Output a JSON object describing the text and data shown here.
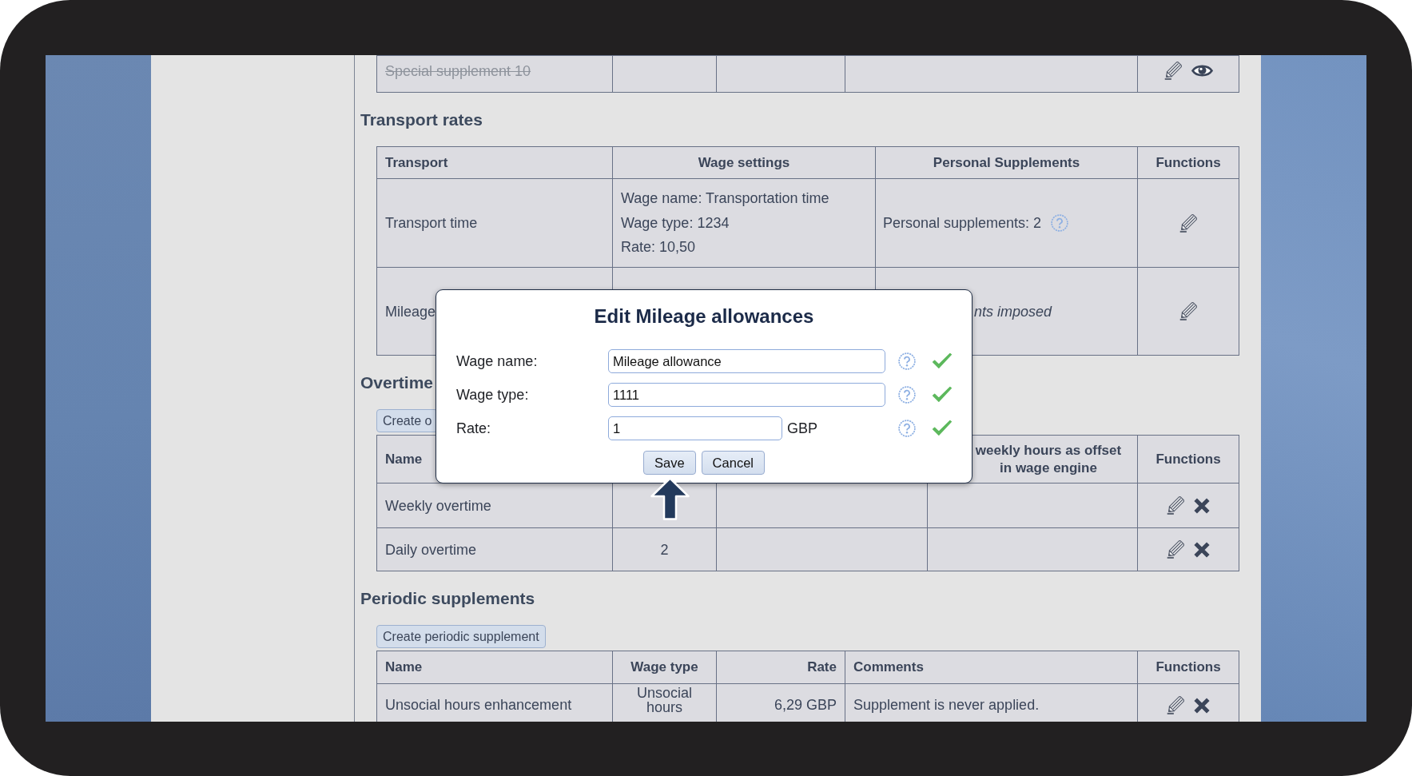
{
  "special_supplements": {
    "rows": [
      {
        "name": "Special supplement 10",
        "disabled": true,
        "actions": [
          {
            "kind": "edit"
          },
          {
            "kind": "view"
          }
        ]
      }
    ]
  },
  "transport_rates": {
    "title": "Transport rates",
    "columns": [
      "Transport",
      "Wage settings",
      "Personal Supplements",
      "Functions"
    ],
    "rows": [
      {
        "transport": "Transport time",
        "wage_settings": [
          "Wage name: Transportation time",
          "Wage type: 1234",
          "Rate: 10,50"
        ],
        "personal_supplements": {
          "kind": "count",
          "text": "Personal supplements: 2"
        },
        "actions": [
          {
            "kind": "edit"
          }
        ]
      },
      {
        "transport": "Mileage",
        "personal_supplements": {
          "kind": "note",
          "text": "nts imposed"
        },
        "actions": [
          {
            "kind": "edit"
          }
        ]
      }
    ]
  },
  "overtime": {
    "title": "Overtime",
    "create_button": "Create o",
    "columns": {
      "name": "Name",
      "column_4": "weekly hours as offset\nin wage engine",
      "functions": "Functions"
    },
    "rows": [
      {
        "name": "Weekly overtime",
        "actions": [
          {
            "kind": "edit"
          },
          {
            "kind": "delete"
          }
        ]
      },
      {
        "name": "Daily overtime",
        "column_2": "2",
        "actions": [
          {
            "kind": "edit"
          },
          {
            "kind": "delete"
          }
        ]
      }
    ]
  },
  "periodic_supplements": {
    "title": "Periodic supplements",
    "create_button": "Create periodic supplement",
    "columns": [
      "Name",
      "Wage type",
      "Rate",
      "Comments",
      "Functions"
    ],
    "rows": [
      {
        "name": "Unsocial hours enhancement",
        "wage_type": "Unsocial hours",
        "rate": "6,29 GBP",
        "comments": "Supplement is never applied.",
        "actions": [
          {
            "kind": "edit"
          },
          {
            "kind": "delete"
          }
        ]
      }
    ]
  },
  "dialog": {
    "title": "Edit Mileage allowances",
    "fields": [
      {
        "label": "Wage name:",
        "value": "Mileage allowance",
        "valid": true
      },
      {
        "label": "Wage type:",
        "value": "1111",
        "valid": true
      },
      {
        "label": "Rate:",
        "value": "1",
        "unit": "GBP",
        "valid": true
      }
    ],
    "buttons": [
      "Save",
      "Cancel"
    ]
  }
}
